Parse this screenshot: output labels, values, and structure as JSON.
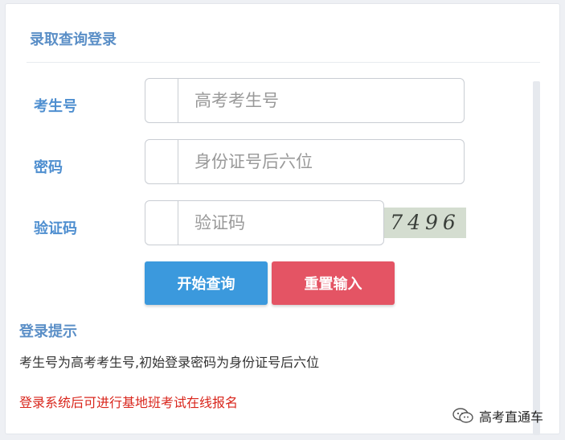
{
  "card": {
    "title": "录取查询登录"
  },
  "form": {
    "exam_id": {
      "label": "考生号",
      "placeholder": "高考考生号",
      "value": ""
    },
    "password": {
      "label": "密码",
      "placeholder": "身份证号后六位",
      "value": ""
    },
    "captcha": {
      "label": "验证码",
      "placeholder": "验证码",
      "value": "",
      "image_text": "7496"
    }
  },
  "buttons": {
    "query_label": "开始查询",
    "reset_label": "重置输入"
  },
  "tips": {
    "title": "登录提示",
    "text": "考生号为高考考生号,初始登录密码为身份证号后六位",
    "notice": "登录系统后可进行基地班考试在线报名"
  },
  "watermark": {
    "text": "高考直通车",
    "icon": "wechat-icon"
  },
  "colors": {
    "label_blue": "#4f8fd0",
    "title_blue": "#5b8fc7",
    "query_button": "#3b99dd",
    "reset_button": "#e45464",
    "notice_red": "#d9261c"
  }
}
